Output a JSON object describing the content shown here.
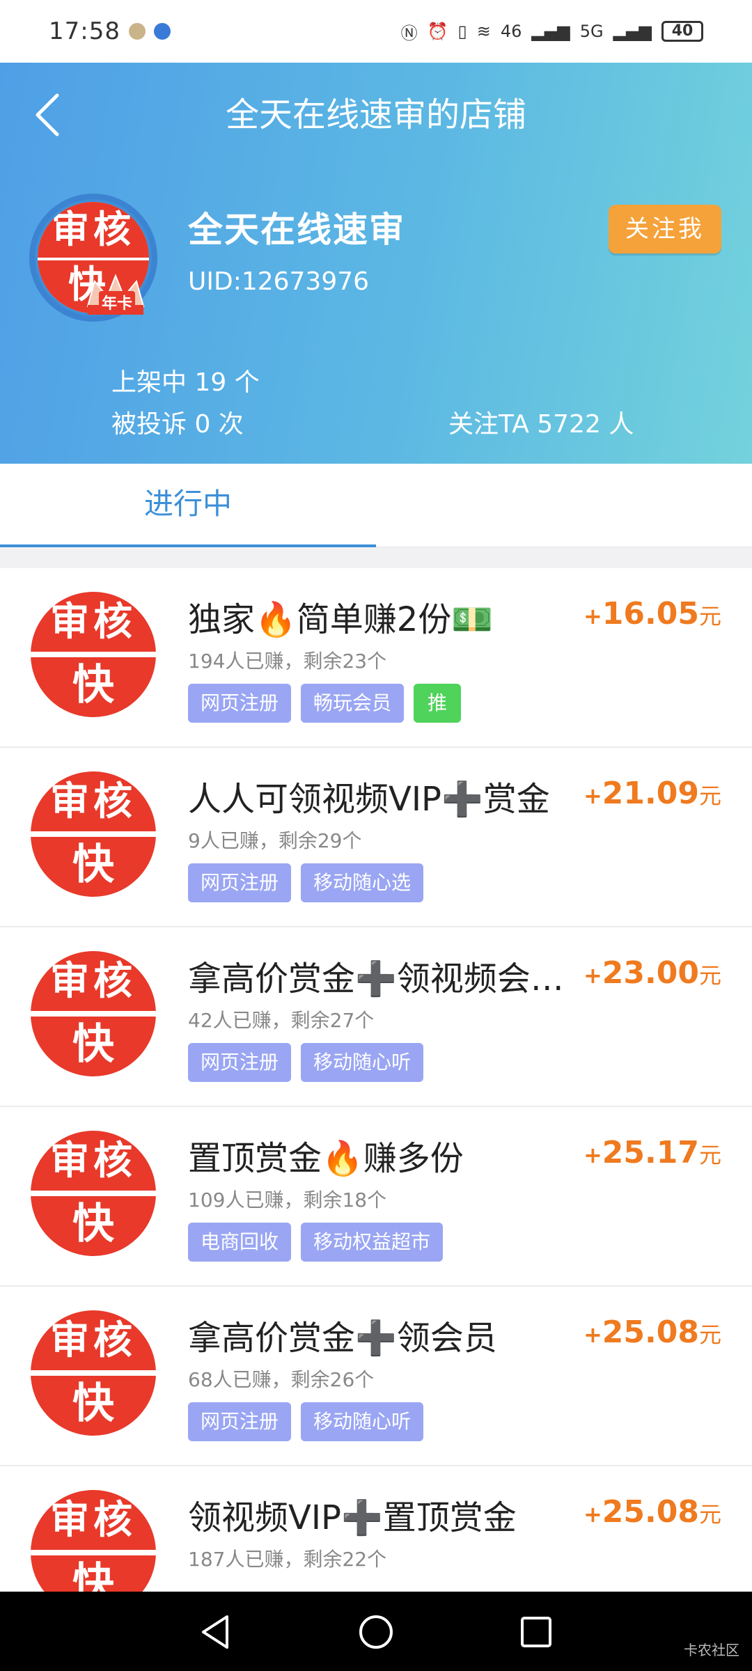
{
  "status_bar": {
    "time": "17:58",
    "network_left": "46",
    "network_right": "5G",
    "battery": "40"
  },
  "header": {
    "title": "全天在线速审的店铺",
    "shop_name": "全天在线速审",
    "uid": "UID:12673976",
    "follow_label": "关注我",
    "avatar_top": "审核",
    "avatar_bottom": "快",
    "avatar_badge": "年卡",
    "stats": {
      "listed": "上架中 19 个",
      "complaints": "被投诉 0 次",
      "followers": "关注TA 5722 人"
    }
  },
  "tabs": {
    "active": "进行中"
  },
  "tasks": [
    {
      "title": "独家🔥简单赚2份💵",
      "meta": "194人已赚，剩余23个",
      "tags": [
        "网页注册",
        "畅玩会员",
        "推"
      ],
      "plus": "+",
      "price": "16.05",
      "unit": "元"
    },
    {
      "title": "人人可领视频VIP➕赏金",
      "meta": "9人已赚，剩余29个",
      "tags": [
        "网页注册",
        "移动随心选"
      ],
      "plus": "+",
      "price": "21.09",
      "unit": "元"
    },
    {
      "title": "拿高价赏金➕领视频会…",
      "meta": "42人已赚，剩余27个",
      "tags": [
        "网页注册",
        "移动随心听"
      ],
      "plus": "+",
      "price": "23.00",
      "unit": "元"
    },
    {
      "title": "置顶赏金🔥赚多份",
      "meta": "109人已赚，剩余18个",
      "tags": [
        "电商回收",
        "移动权益超市"
      ],
      "plus": "+",
      "price": "25.17",
      "unit": "元"
    },
    {
      "title": "拿高价赏金➕领会员",
      "meta": "68人已赚，剩余26个",
      "tags": [
        "网页注册",
        "移动随心听"
      ],
      "plus": "+",
      "price": "25.08",
      "unit": "元"
    },
    {
      "title": "领视频VIP➕置顶赏金",
      "meta": "187人已赚，剩余22个",
      "tags": [],
      "plus": "+",
      "price": "25.08",
      "unit": "元"
    }
  ],
  "task_avatar": {
    "top": "审核",
    "bottom": "快"
  },
  "watermark": "卡农社区",
  "colors": {
    "accent_blue": "#3d8fd8",
    "price_orange": "#ef7a1f",
    "follow_orange": "#f5a23a",
    "tag_purple": "#9aa6f3",
    "tag_green": "#4fd35a",
    "avatar_red": "#e8392a"
  }
}
